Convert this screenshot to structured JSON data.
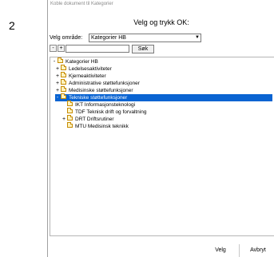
{
  "step_number": "2",
  "dialog": {
    "title": "Koble dokument til Kategorier",
    "heading": "Velg og trykk OK:",
    "area_label": "Velg område:",
    "area_value": "Kategorier HB",
    "expand_all": "+",
    "collapse_all": "-",
    "search_value": "",
    "search_button": "Søk",
    "tree": [
      {
        "label": "Kategorier HB",
        "expander": "-",
        "level": 0,
        "selected": false
      },
      {
        "label": "Ledelsesaktiviteter",
        "expander": "+",
        "level": 1,
        "selected": false
      },
      {
        "label": "Kjerneaktiviteter",
        "expander": "+",
        "level": 1,
        "selected": false
      },
      {
        "label": "Administrative støttefunksjoner",
        "expander": "+",
        "level": 1,
        "selected": false
      },
      {
        "label": "Medisinske støttefunksjoner",
        "expander": "+",
        "level": 1,
        "selected": false
      },
      {
        "label": "Tekniske støttefunksjoner",
        "expander": "-",
        "level": 1,
        "selected": true
      },
      {
        "label": "IKT Informasjonsteknologi",
        "expander": "",
        "level": 2,
        "selected": false
      },
      {
        "label": "TDF Teknisk drift og forvaltning",
        "expander": "",
        "level": 2,
        "selected": false
      },
      {
        "label": "DRT Driftsrutiner",
        "expander": "+",
        "level": 2,
        "selected": false
      },
      {
        "label": "MTU Medisinsk teknikk",
        "expander": "",
        "level": 2,
        "selected": false
      }
    ],
    "ok_button": "Velg",
    "cancel_button": "Avbryt"
  },
  "colors": {
    "selection": "#0a64d2",
    "folder": "#fff3c0"
  }
}
